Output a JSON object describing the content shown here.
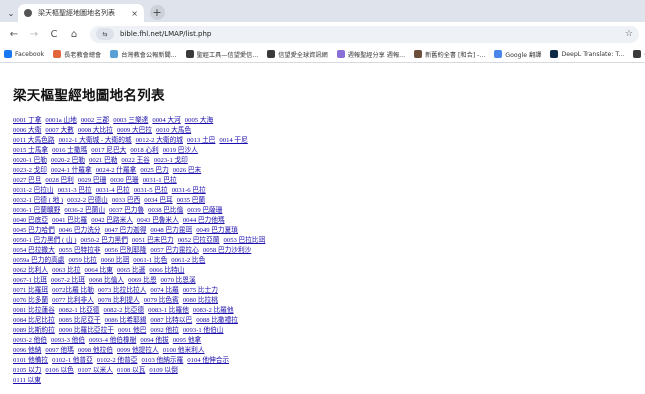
{
  "browser": {
    "tab_title": "梁天樞聖經地圖地名列表",
    "tab_close": "×",
    "new_tab": "+",
    "url": "bible.fhl.net/LMAP/list.php",
    "nav": {
      "back": "←",
      "forward": "→",
      "reload": "C",
      "home": "⌂"
    },
    "site_info": "⇆",
    "bookmark_star": "☆",
    "tab_menu": "⌄"
  },
  "bookmarks": [
    {
      "label": "Facebook",
      "color": "#1877f2"
    },
    {
      "label": "長老教會總會",
      "color": "#e2653c"
    },
    {
      "label": "台灣教會公報新聞...",
      "color": "#5aa0d6"
    },
    {
      "label": "聖經工具—信望愛信...",
      "color": "#3a3a3a"
    },
    {
      "label": "信望愛全球資訊網",
      "color": "#3a3a3a"
    },
    {
      "label": "週報聖經分享 週報...",
      "color": "#8a6fd6"
    },
    {
      "label": "新舊約全書 [和合] -...",
      "color": "#6b4f3a"
    },
    {
      "label": "Google 翻譯",
      "color": "#4a86e8"
    },
    {
      "label": "DeepL Translate: T...",
      "color": "#0f2b46"
    },
    {
      "label": "信望愛站 ...",
      "color": "#3a3a3a"
    }
  ],
  "page": {
    "title": "梁天樞聖經地圖地名列表",
    "rows": [
      [
        "0001 丁拿",
        "0001a 山地",
        "0002 三郡",
        "0003 三樂達",
        "0004 大河",
        "0005 大海"
      ],
      [
        "0006 大衛",
        "0007 大數",
        "0008 大比拉",
        "0009 大巴拉",
        "0010 大馬色"
      ],
      [
        "0011 大馬色路",
        "0012-1 大衛城 - 大衛的城",
        "0012-2 大衛的城",
        "0013 土巴",
        "0014 干尼"
      ],
      [
        "0015 士馬拿",
        "0016 士撒瑪",
        "0017 尼巴大",
        "0018 心利",
        "0019 巴沙人"
      ],
      [
        "0020-1 巴勒",
        "0020-2 巴勒",
        "0021 巴勒",
        "0022 王谷",
        "0023-1 戈印"
      ],
      [
        "0023-2 戈印",
        "0024-1 什羅拿",
        "0024-2 什羅拿",
        "0025 巴力",
        "0026 巴末"
      ],
      [
        "0027 巴旦",
        "0028 巴利",
        "0029 巴珊",
        "0030 巴珊",
        "0031-1 巴拉"
      ],
      [
        "0031-2 巴拉山",
        "0031-3 巴拉",
        "0031-4 巴拉",
        "0031-5 巴拉",
        "0031-6 巴拉"
      ],
      [
        "0032-1 巴德 ( 地 )",
        "0032-2 巴德山",
        "0033 巴西",
        "0034 巴耳",
        "0035 巴蘭"
      ],
      [
        "0036-1 巴蘭曠野",
        "0036-2 巴蘭山",
        "0037 巴力魯",
        "0038 巴比倫",
        "0039 巴薩珊"
      ],
      [
        "0040 巴底亞",
        "0041 巴比羅",
        "0042 巴路米人",
        "0043 巴魯米人",
        "0044 巴力他瑪"
      ],
      [
        "0045 巴力哈們",
        "0046 巴力洗分",
        "0047 巴力迦得",
        "0048 巴力毘珥",
        "0049 巴力夏瑣"
      ],
      [
        "0050-1 巴力黑們 ( 山 )",
        "0050-2 巴力黑們",
        "0051 巴末巴力",
        "0052 巴拉亞蘭",
        "0053 巴拉比珥"
      ],
      [
        "0054 巴拉撒大",
        "0055 巴特拉非",
        "0056 巴別耶隆",
        "0057 巴力毘拉心",
        "0058 巴力沙利沙"
      ],
      [
        "0059a 巴力的高處",
        "0059 比拉",
        "0060 比珥",
        "0061-1 比色",
        "0061-2 比色"
      ],
      [
        "0062 比利人",
        "0063 比拉",
        "0064 比東",
        "0065 比遜",
        "0066 比特山"
      ],
      [
        "0067-1 比珥",
        "0067-2 比珥",
        "0068 比倫人",
        "0069 比恩",
        "0070 比恩溪"
      ],
      [
        "0071 比羅珥",
        "0072比羅 比勒",
        "0073 比拉比拉人",
        "0074 比羅",
        "0075 比士力"
      ],
      [
        "0076 比多蘭",
        "0077 比利非人",
        "0078 比利提人",
        "0079 比色賓",
        "0080 比拉桃"
      ],
      [
        "0081 比拉蓮谷",
        "0082-1 比亞德",
        "0082-2 比亞德",
        "0083-1 比羅他",
        "0083-2 比羅他"
      ],
      [
        "0084 比尼比拉",
        "0085 比尼亞干",
        "0086 比希耶錫",
        "0087 比特以巴",
        "0088 比撒禮拉"
      ],
      [
        "0089 比斯約拉",
        "0090 比羅比亞拉干",
        "0091 他巴",
        "0092 他拉",
        "0093-1 他伯山"
      ],
      [
        "0093-2 他伯",
        "0093-3 他伯",
        "0093-4 他伯橡樹",
        "0094 他拔",
        "0095 他拿"
      ],
      [
        "0096 他納",
        "0097 他瑪",
        "0098 他拉伯",
        "0099 他提拉人",
        "0100 他米利人"
      ],
      [
        "0101 他備拉",
        "0102-1 他普亞",
        "0102-2 他普亞",
        "0103 他納示羅",
        "0104 他伸合示"
      ],
      [
        "0105 以力",
        "0106 以色",
        "0107 以米人",
        "0108 以瓦",
        "0109 以倒"
      ],
      [
        "0111 以東"
      ]
    ]
  }
}
